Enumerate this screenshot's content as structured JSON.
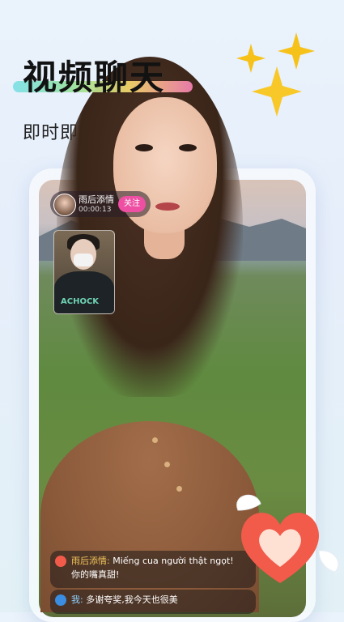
{
  "hero": {
    "title": "视频聊天",
    "subtitle": "即时即刻 没有距离"
  },
  "call": {
    "caller_name": "雨后添情",
    "timer": "00:00:13",
    "follow_label": "关注",
    "pip_shirt_text": "ACHOCK"
  },
  "chat": [
    {
      "sender": "雨后添情:",
      "text": "Miếng cua người thật ngọt!",
      "text2": "你的嘴真甜!"
    },
    {
      "sender": "我:",
      "text": "多谢夸奖,我今天也很美"
    }
  ],
  "colors": {
    "follow": "#ee4fa3",
    "sparkle": "#f6c21a",
    "heart": "#f25a4a"
  }
}
